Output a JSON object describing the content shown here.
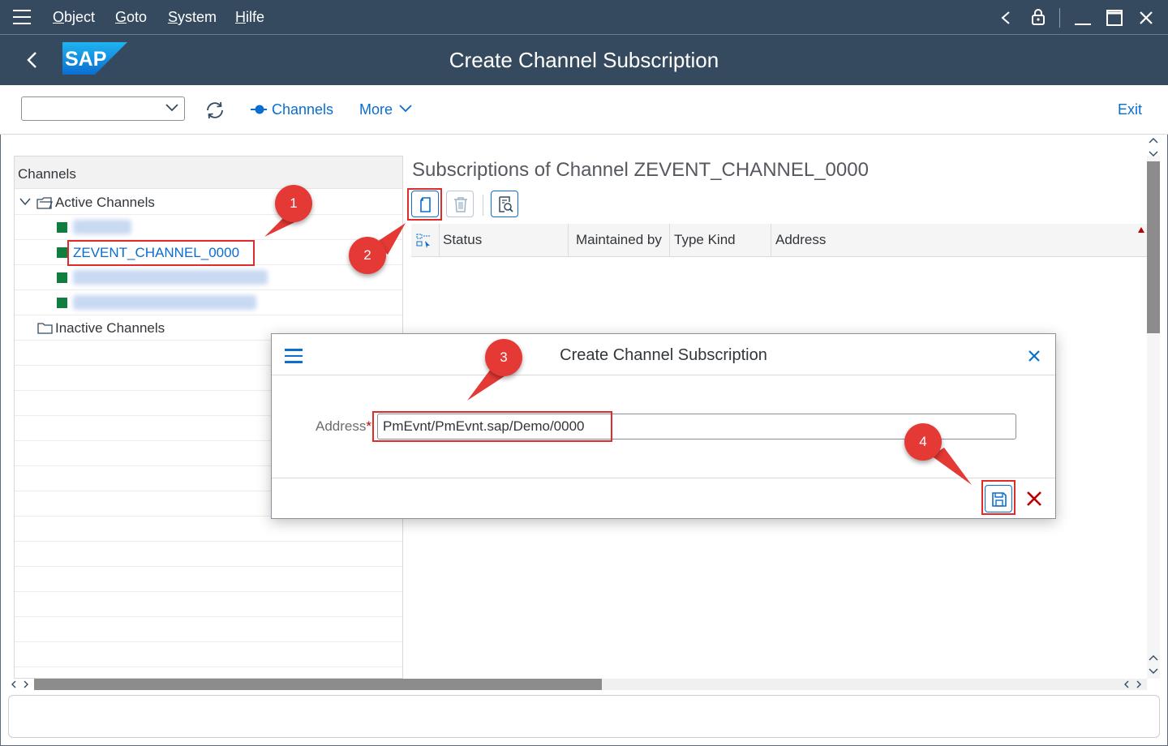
{
  "menubar": {
    "items": [
      {
        "label": "Object"
      },
      {
        "label": "Goto"
      },
      {
        "label": "System"
      },
      {
        "label": "Hilfe"
      }
    ]
  },
  "shell": {
    "logo_text": "SAP",
    "title": "Create Channel Subscription"
  },
  "toolbar": {
    "select_value": "",
    "channels_label": "Channels",
    "more_label": "More",
    "exit_label": "Exit"
  },
  "tree": {
    "header": "Channels",
    "active_label": "Active Channels",
    "selected_channel": "ZEVENT_CHANNEL_0000",
    "inactive_label": "Inactive Channels"
  },
  "main": {
    "title": "Subscriptions of Channel ZEVENT_CHANNEL_0000",
    "columns": [
      "Status",
      "Maintained by",
      "Type Kind",
      "Address"
    ]
  },
  "dialog": {
    "title": "Create Channel Subscription",
    "address_label": "Address",
    "required_marker": "*",
    "address_value": "PmEvnt/PmEvnt.sap/Demo/0000"
  },
  "annotations": {
    "step1": "1",
    "step2": "2",
    "step3": "3",
    "step4": "4"
  },
  "colors": {
    "shell_bg": "#354a5f",
    "accent": "#0a6ed1",
    "active_status": "#107e3e",
    "highlight": "#e02b2b",
    "badge": "#e53935",
    "cancel": "#bb0000"
  }
}
